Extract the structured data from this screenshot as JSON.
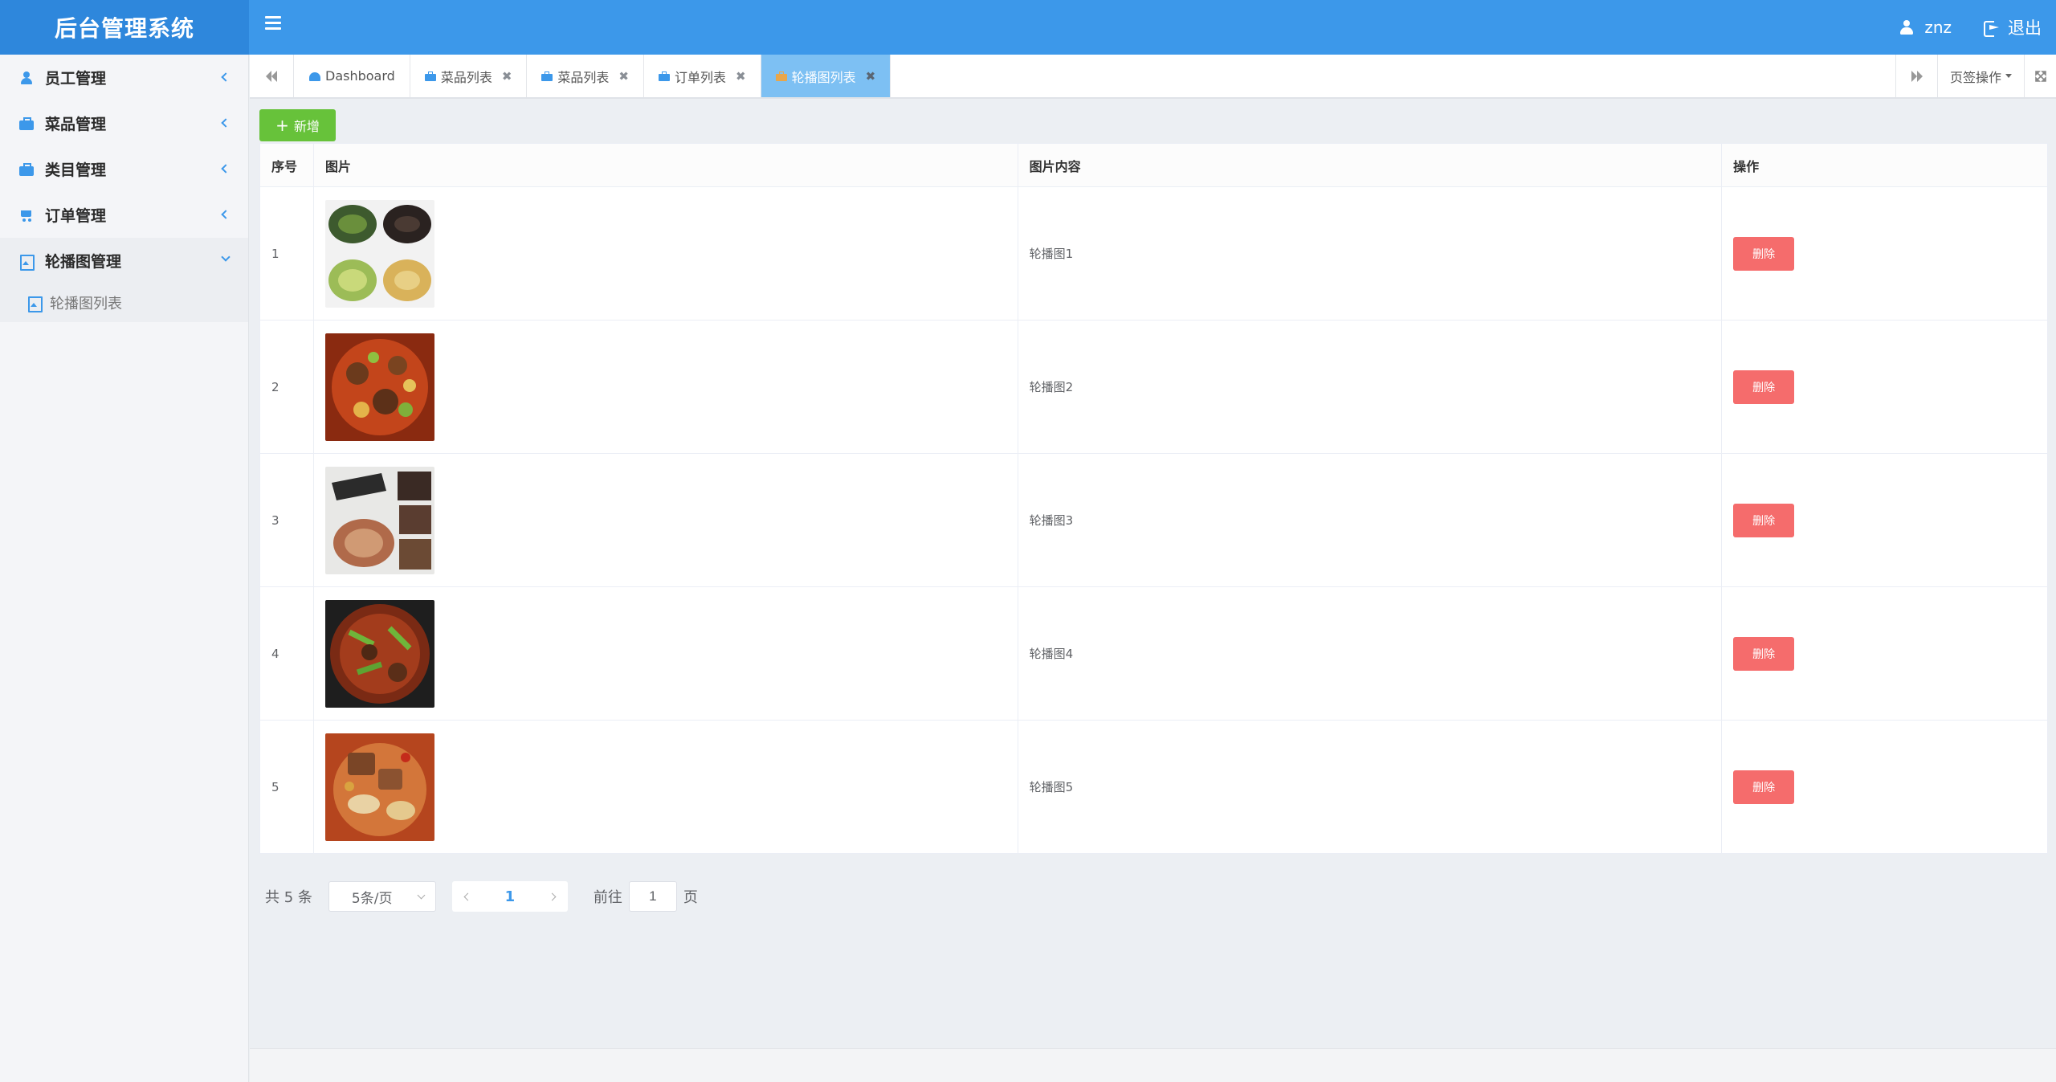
{
  "app": {
    "title": "后台管理系统"
  },
  "header": {
    "username": "znz",
    "logout_label": "退出"
  },
  "sidebar": {
    "items": [
      {
        "label": "员工管理",
        "icon": "user-icon"
      },
      {
        "label": "菜品管理",
        "icon": "briefcase-icon"
      },
      {
        "label": "类目管理",
        "icon": "briefcase-icon"
      },
      {
        "label": "订单管理",
        "icon": "cart-icon"
      },
      {
        "label": "轮播图管理",
        "icon": "picture-icon",
        "expanded": true
      }
    ],
    "sub_items": [
      {
        "label": "轮播图列表",
        "icon": "picture-icon"
      }
    ]
  },
  "tabs": {
    "items": [
      {
        "label": "Dashboard",
        "icon": "dashboard-icon",
        "closable": false
      },
      {
        "label": "菜品列表",
        "icon": "briefcase-icon",
        "closable": true
      },
      {
        "label": "菜品列表",
        "icon": "briefcase-icon",
        "closable": true
      },
      {
        "label": "订单列表",
        "icon": "briefcase-icon",
        "closable": true
      },
      {
        "label": "轮播图列表",
        "icon": "briefcase-icon",
        "closable": true,
        "active": true
      }
    ],
    "page_ops_label": "页签操作"
  },
  "toolbar": {
    "add_label": "新增"
  },
  "table": {
    "headers": {
      "index": "序号",
      "image": "图片",
      "content": "图片内容",
      "actions": "操作"
    },
    "rows": [
      {
        "index": "1",
        "content": "轮播图1",
        "delete_label": "删除"
      },
      {
        "index": "2",
        "content": "轮播图2",
        "delete_label": "删除"
      },
      {
        "index": "3",
        "content": "轮播图3",
        "delete_label": "删除"
      },
      {
        "index": "4",
        "content": "轮播图4",
        "delete_label": "删除"
      },
      {
        "index": "5",
        "content": "轮播图5",
        "delete_label": "删除"
      }
    ]
  },
  "pagination": {
    "total_label": "共 5 条",
    "page_size_label": "5条/页",
    "current_page": "1",
    "goto_prefix": "前往",
    "goto_value": "1",
    "goto_suffix": "页"
  },
  "colors": {
    "header": "#3c98ea",
    "brand": "#2e87dc",
    "add": "#67c23a",
    "delete": "#f56c6c",
    "active_tab": "#7dc0f3"
  }
}
